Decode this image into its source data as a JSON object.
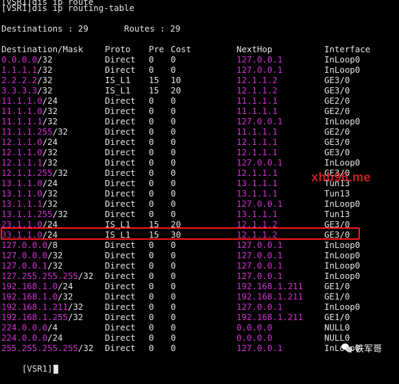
{
  "terminal": {
    "cut_line": "[VSR1]dis ip route",
    "command_line": "[VSR1]dis ip routing-table",
    "summary": "Destinations : 29       Routes : 29",
    "headers": {
      "dest": "Destination/Mask",
      "proto": "Proto",
      "pre": "Pre",
      "cost": "Cost",
      "next": "NextHop",
      "iface": "Interface"
    },
    "rows": [
      {
        "ip": "0.0.0.0",
        "mask": "/32",
        "proto": "Direct",
        "pre": "0",
        "cost": "0",
        "next": "127.0.0.1",
        "iface": "InLoop0"
      },
      {
        "ip": "1.1.1.1",
        "mask": "/32",
        "proto": "Direct",
        "pre": "0",
        "cost": "0",
        "next": "127.0.0.1",
        "iface": "InLoop0"
      },
      {
        "ip": "2.2.2.2",
        "mask": "/32",
        "proto": "IS_L1",
        "pre": "15",
        "cost": "10",
        "next": "12.1.1.2",
        "iface": "GE3/0"
      },
      {
        "ip": "3.3.3.3",
        "mask": "/32",
        "proto": "IS_L1",
        "pre": "15",
        "cost": "20",
        "next": "12.1.1.2",
        "iface": "GE3/0"
      },
      {
        "ip": "11.1.1.0",
        "mask": "/24",
        "proto": "Direct",
        "pre": "0",
        "cost": "0",
        "next": "11.1.1.1",
        "iface": "GE2/0"
      },
      {
        "ip": "11.1.1.0",
        "mask": "/32",
        "proto": "Direct",
        "pre": "0",
        "cost": "0",
        "next": "11.1.1.1",
        "iface": "GE2/0"
      },
      {
        "ip": "11.1.1.1",
        "mask": "/32",
        "proto": "Direct",
        "pre": "0",
        "cost": "0",
        "next": "127.0.0.1",
        "iface": "InLoop0"
      },
      {
        "ip": "11.1.1.255",
        "mask": "/32",
        "proto": "Direct",
        "pre": "0",
        "cost": "0",
        "next": "11.1.1.1",
        "iface": "GE2/0"
      },
      {
        "ip": "12.1.1.0",
        "mask": "/24",
        "proto": "Direct",
        "pre": "0",
        "cost": "0",
        "next": "12.1.1.1",
        "iface": "GE3/0"
      },
      {
        "ip": "12.1.1.0",
        "mask": "/32",
        "proto": "Direct",
        "pre": "0",
        "cost": "0",
        "next": "12.1.1.1",
        "iface": "GE3/0"
      },
      {
        "ip": "12.1.1.1",
        "mask": "/32",
        "proto": "Direct",
        "pre": "0",
        "cost": "0",
        "next": "127.0.0.1",
        "iface": "InLoop0"
      },
      {
        "ip": "12.1.1.255",
        "mask": "/32",
        "proto": "Direct",
        "pre": "0",
        "cost": "0",
        "next": "12.1.1.1",
        "iface": "GE3/0"
      },
      {
        "ip": "13.1.1.0",
        "mask": "/24",
        "proto": "Direct",
        "pre": "0",
        "cost": "0",
        "next": "13.1.1.1",
        "iface": "Tun13"
      },
      {
        "ip": "13.1.1.0",
        "mask": "/32",
        "proto": "Direct",
        "pre": "0",
        "cost": "0",
        "next": "13.1.1.1",
        "iface": "Tun13"
      },
      {
        "ip": "13.1.1.1",
        "mask": "/32",
        "proto": "Direct",
        "pre": "0",
        "cost": "0",
        "next": "127.0.0.1",
        "iface": "InLoop0"
      },
      {
        "ip": "13.1.1.255",
        "mask": "/32",
        "proto": "Direct",
        "pre": "0",
        "cost": "0",
        "next": "13.1.1.1",
        "iface": "Tun13"
      },
      {
        "ip": "23.1.1.0",
        "mask": "/24",
        "proto": "IS_L1",
        "pre": "15",
        "cost": "20",
        "next": "12.1.1.2",
        "iface": "GE3/0"
      },
      {
        "ip": "33.1.1.0",
        "mask": "/24",
        "proto": "IS_L1",
        "pre": "15",
        "cost": "30",
        "next": "12.1.1.2",
        "iface": "GE3/0"
      },
      {
        "ip": "127.0.0.0",
        "mask": "/8",
        "proto": "Direct",
        "pre": "0",
        "cost": "0",
        "next": "127.0.0.1",
        "iface": "InLoop0"
      },
      {
        "ip": "127.0.0.0",
        "mask": "/32",
        "proto": "Direct",
        "pre": "0",
        "cost": "0",
        "next": "127.0.0.1",
        "iface": "InLoop0"
      },
      {
        "ip": "127.0.0.1",
        "mask": "/32",
        "proto": "Direct",
        "pre": "0",
        "cost": "0",
        "next": "127.0.0.1",
        "iface": "InLoop0"
      },
      {
        "ip": "127.255.255.255",
        "mask": "/32",
        "proto": "Direct",
        "pre": "0",
        "cost": "0",
        "next": "127.0.0.1",
        "iface": "InLoop0"
      },
      {
        "ip": "192.168.1.0",
        "mask": "/24",
        "proto": "Direct",
        "pre": "0",
        "cost": "0",
        "next": "192.168.1.211",
        "iface": "GE1/0"
      },
      {
        "ip": "192.168.1.0",
        "mask": "/32",
        "proto": "Direct",
        "pre": "0",
        "cost": "0",
        "next": "192.168.1.211",
        "iface": "GE1/0"
      },
      {
        "ip": "192.168.1.211",
        "mask": "/32",
        "proto": "Direct",
        "pre": "0",
        "cost": "0",
        "next": "127.0.0.1",
        "iface": "InLoop0"
      },
      {
        "ip": "192.168.1.255",
        "mask": "/32",
        "proto": "Direct",
        "pre": "0",
        "cost": "0",
        "next": "192.168.1.211",
        "iface": "GE1/0"
      },
      {
        "ip": "224.0.0.0",
        "mask": "/4",
        "proto": "Direct",
        "pre": "0",
        "cost": "0",
        "next": "0.0.0.0",
        "iface": "NULL0"
      },
      {
        "ip": "224.0.0.0",
        "mask": "/24",
        "proto": "Direct",
        "pre": "0",
        "cost": "0",
        "next": "0.0.0.0",
        "iface": "NULL0"
      },
      {
        "ip": "255.255.255.255",
        "mask": "/32",
        "proto": "Direct",
        "pre": "0",
        "cost": "0",
        "next": "127.0.0.1",
        "iface": "InLoop0"
      }
    ],
    "prompt": "[VSR1]"
  },
  "overlays": {
    "watermark_text": "xhb96.me",
    "brand_text": "铁军哥",
    "highlight_color": "#ff1a1a",
    "ip_color": "#d62fd6"
  }
}
